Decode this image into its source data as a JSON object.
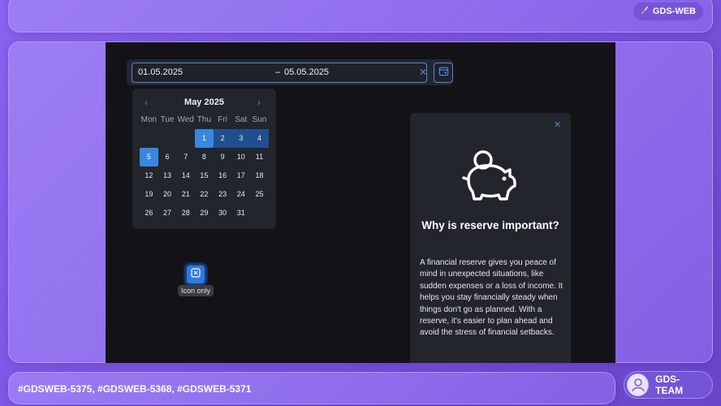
{
  "header": {
    "badge_label": "GDS-WEB",
    "badge_icon": "paint-brush-icon"
  },
  "footer": {
    "tickets": "#GDSWEB-5375, #GDSWEB-5368, #GDSWEB-5371",
    "team_label": "GDS-TEAM",
    "team_icon": "user-icon"
  },
  "date_range": {
    "start": "01.05.2025",
    "separator": "–",
    "end": "05.05.2025",
    "clear_icon": "close-icon",
    "toggle_icon": "calendar-icon",
    "accent": "#4d88d8"
  },
  "calendar": {
    "month_label": "May 2025",
    "prev_icon": "chevron-left-icon",
    "next_icon": "chevron-right-icon",
    "weekdays": [
      "Mon",
      "Tue",
      "Wed",
      "Thu",
      "Fri",
      "Sat",
      "Sun"
    ],
    "leading_blanks": 3,
    "days": [
      "1",
      "2",
      "3",
      "4",
      "5",
      "6",
      "7",
      "8",
      "9",
      "10",
      "11",
      "12",
      "13",
      "14",
      "15",
      "16",
      "17",
      "18",
      "19",
      "20",
      "21",
      "22",
      "23",
      "24",
      "25",
      "26",
      "27",
      "28",
      "29",
      "30",
      "31"
    ],
    "range_start": 1,
    "range_end": 5,
    "selected_color": "#3b86e0",
    "range_color": "#1f4f8e"
  },
  "icon_button": {
    "tooltip": "Icon only",
    "icon": "close-box-icon"
  },
  "reserve_card": {
    "close_icon": "close-icon",
    "illustration": "piggy-bank-icon",
    "title": "Why is reserve important?",
    "body": "A financial reserve gives you peace of mind in unexpected situations, like sudden expenses or a loss of income. It helps you stay financially steady when things don't go as planned. With a reserve, it's easier to plan ahead and avoid the stress of financial setbacks."
  }
}
